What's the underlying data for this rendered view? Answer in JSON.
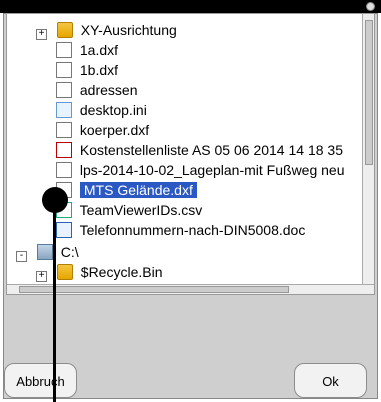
{
  "tree": {
    "items": [
      {
        "label": "XY-Ausrichtung",
        "icon": "folder-icon",
        "expander": "+"
      },
      {
        "label": "1a.dxf",
        "icon": "file-icon"
      },
      {
        "label": "1b.dxf",
        "icon": "file-icon"
      },
      {
        "label": "adressen",
        "icon": "file-icon"
      },
      {
        "label": "desktop.ini",
        "icon": "ini-file-icon"
      },
      {
        "label": "koerper.dxf",
        "icon": "file-icon"
      },
      {
        "label": "Kostenstellenliste AS 05 06 2014 14 18 35",
        "icon": "pdf-file-icon"
      },
      {
        "label": "lps-2014-10-02_Lageplan-mit Fußweg neu",
        "icon": "file-icon"
      },
      {
        "label": "MTS Gelände.dxf",
        "icon": "file-icon",
        "selected": true
      },
      {
        "label": "TeamViewerIDs.csv",
        "icon": "csv-file-icon"
      },
      {
        "label": "Telefonnummern-nach-DIN5008.doc",
        "icon": "doc-file-icon"
      },
      {
        "label": "C:\\",
        "icon": "drive-icon",
        "expander": "-"
      },
      {
        "label": "$Recycle.Bin",
        "icon": "folder-icon",
        "expander": "+"
      }
    ]
  },
  "buttons": {
    "cancel": "Abbruch",
    "ok": "Ok"
  }
}
